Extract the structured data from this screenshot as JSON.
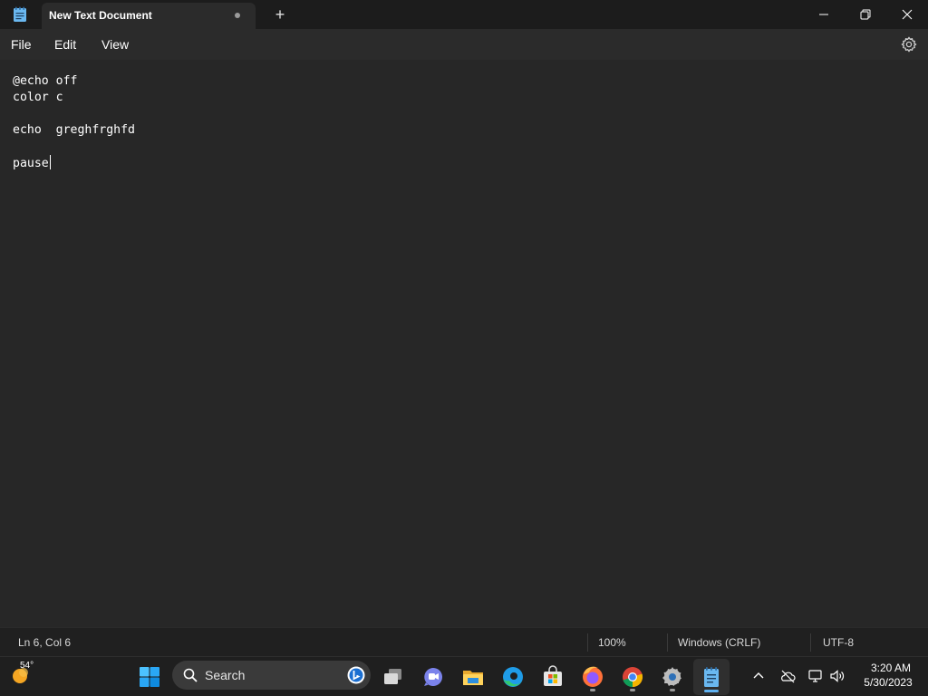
{
  "window": {
    "app_icon": "notepad-icon",
    "tab_title": "New Text Document",
    "tab_unsaved_indicator": "dot",
    "new_tab_label": "+",
    "controls": [
      "minimize-icon",
      "restore-icon",
      "close-icon"
    ]
  },
  "menu": {
    "items": [
      {
        "label": "File"
      },
      {
        "label": "Edit"
      },
      {
        "label": "View"
      }
    ],
    "settings_icon": "gear-icon"
  },
  "editor": {
    "lines": [
      "@echo off",
      "color c",
      "",
      "echo  greghfrghfd",
      "",
      "pause"
    ],
    "caret_line": 6,
    "caret_col": 6
  },
  "status": {
    "position": "Ln 6, Col 6",
    "zoom": "100%",
    "line_ending": "Windows (CRLF)",
    "encoding": "UTF-8"
  },
  "taskbar": {
    "weather_temp": "54°",
    "search_label": "Search",
    "apps": [
      {
        "icon": "windows-start-icon",
        "running": false
      },
      {
        "icon": "task-view-icon",
        "running": false
      },
      {
        "icon": "teams-chat-icon",
        "running": false
      },
      {
        "icon": "file-explorer-icon",
        "running": false
      },
      {
        "icon": "edge-icon",
        "running": false
      },
      {
        "icon": "microsoft-store-icon",
        "running": false
      },
      {
        "icon": "firefox-icon",
        "running": true
      },
      {
        "icon": "chrome-icon",
        "running": true
      },
      {
        "icon": "settings-app-icon",
        "running": true
      },
      {
        "icon": "notepad-icon",
        "running": true,
        "active": true
      }
    ],
    "tray_icons": [
      "chevron-up-icon",
      "onedrive-icon",
      "network-icon",
      "volume-icon"
    ],
    "clock_time": "3:20 AM",
    "clock_date": "5/30/2023"
  },
  "colors": {
    "title_bar": "#1c1c1c",
    "tab_active": "#2b2b2b",
    "editor_bg": "#272727",
    "text": "#ffffff",
    "accent": "#5fb2f2",
    "taskbar": "#1f1f1f"
  }
}
